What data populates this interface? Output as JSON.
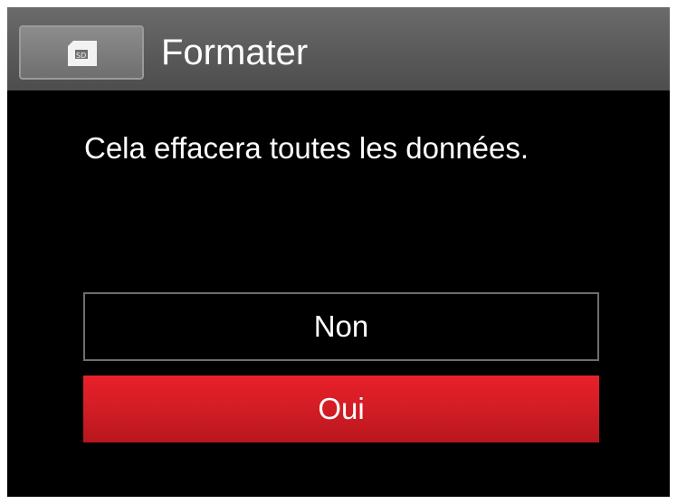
{
  "dialog": {
    "title": "Formater",
    "icon": "sd-card-icon",
    "message": "Cela effacera toutes les données.",
    "options": [
      {
        "label": "Non",
        "selected": false
      },
      {
        "label": "Oui",
        "selected": true
      }
    ]
  },
  "colors": {
    "background": "#000000",
    "header": "#5a5a5a",
    "selected": "#d21d25",
    "text": "#ffffff"
  }
}
